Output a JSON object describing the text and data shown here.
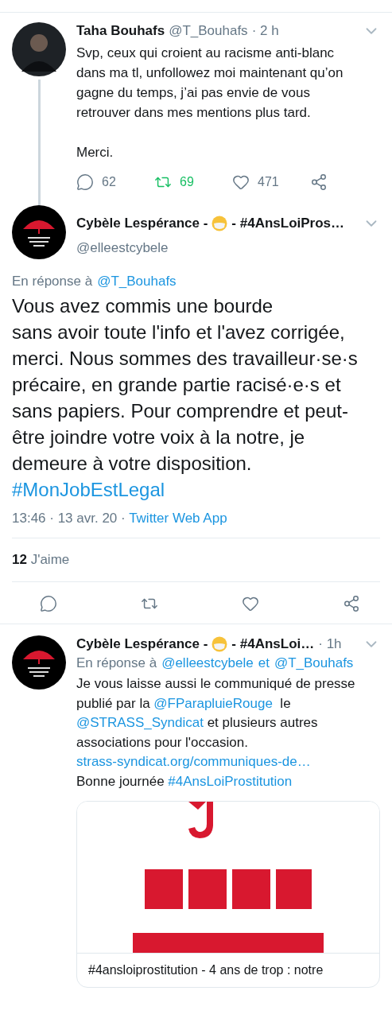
{
  "thread_tweet": {
    "name": "Taha Bouhafs",
    "handle": "@T_Bouhafs",
    "time": "· 2 h",
    "text": [
      {
        "kind": "text",
        "text": "Svp, ceux qui croient au racisme anti-blanc dans ma tl, unfollowez moi maintenant qu’on gagne du temps, j’ai pas envie de vous retrouver dans mes mentions plus tard.\n\nMerci."
      }
    ],
    "actions": {
      "replies": "62",
      "retweets": "69",
      "likes": "471",
      "retweeted": true
    }
  },
  "focused_tweet": {
    "name_start": "Cybèle Lespérance -",
    "name_end": "- #4AnsLoiPros…",
    "handle": "@elleestcybele",
    "reply_to": [
      {
        "kind": "text",
        "text": "En réponse à"
      },
      {
        "kind": "link",
        "text": "@T_Bouhafs"
      }
    ],
    "text": [
      {
        "kind": "text",
        "text": "Vous avez commis une bourde\nsans avoir toute l'info et l'avez corrigée, merci. Nous sommes des travailleur·se·s précaire, en grande partie racisé·e·s et sans papiers. Pour comprendre et peut-être joindre votre voix à la notre, je demeure à votre disposition. "
      },
      {
        "kind": "link",
        "text": "#MonJobEstLegal"
      }
    ],
    "timestamp": "13:46 · 13 avr. 20 ·",
    "source": "Twitter Web App",
    "likes_count": "12",
    "likes_label": "J'aime"
  },
  "reply_tweet": {
    "name_start": "Cybèle Lespérance -",
    "name_end": "- #4AnsLoi…",
    "time": "· 1h",
    "reply_to": [
      {
        "kind": "text",
        "text": "En réponse à"
      },
      {
        "kind": "link",
        "text": "@elleestcybele"
      },
      {
        "kind": "link",
        "text": "et"
      },
      {
        "kind": "link",
        "text": "@T_Bouhafs"
      }
    ],
    "text": [
      {
        "kind": "text",
        "text": "Je vous laisse aussi le communiqué de presse publié par la "
      },
      {
        "kind": "link",
        "text": "@FParapluieRouge"
      },
      {
        "kind": "text",
        "text": "  le "
      },
      {
        "kind": "link",
        "text": "@STRASS_Syndicat"
      },
      {
        "kind": "text",
        "text": " et plusieurs autres associations pour l'occasion.\n"
      },
      {
        "kind": "link",
        "text": "strass-syndicat.org/communiques-de…"
      },
      {
        "kind": "text",
        "text": "\nBonne journée "
      },
      {
        "kind": "link",
        "text": "#4AnsLoiProstitution"
      }
    ],
    "card": {
      "kind": "picture",
      "title": "#4ansloiprostitution - 4 ans de trop : notre"
    }
  }
}
